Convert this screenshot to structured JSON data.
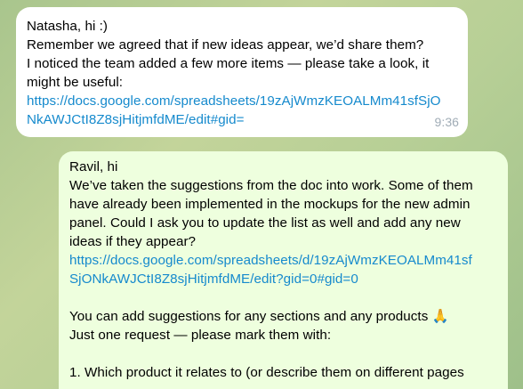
{
  "incoming_message": {
    "lines": [
      "Natasha, hi :)",
      "Remember we agreed that if new ideas appear, we’d share them?",
      "I noticed the team added a few more items — please take a look, it",
      "might be useful:"
    ],
    "link_lines": [
      "https://docs.google.com/spreadsheets/19zAjWmzKEOALMm41sfSjO",
      "NkAWJCtI8Z8sjHitjmfdME/edit#gid="
    ],
    "time": "9:36"
  },
  "outgoing_message": {
    "lines_before_link": [
      "Ravil, hi",
      "We’ve taken the suggestions from the doc into work. Some of them",
      "have already been implemented in the mockups for the new admin",
      "panel. Could I ask you to update the list as well and add any new",
      "ideas if they appear?"
    ],
    "link_lines": [
      "https://docs.google.com/spreadsheets/d/19zAjWmzKEOALMm41sf",
      "SjONkAWJCtI8Z8sjHitjmfdME/edit?gid=0#gid=0"
    ],
    "lines_after_link": [
      "You can add suggestions for any sections and any products 🙏",
      "Just one request — please mark them with:"
    ],
    "list_lines": [
      "1. Which product it relates to (or describe them on different pages"
    ]
  },
  "colors": {
    "link": "#168acd",
    "incoming_bubble": "#ffffff",
    "outgoing_bubble": "#eeffde",
    "timestamp": "#a0acb6"
  }
}
